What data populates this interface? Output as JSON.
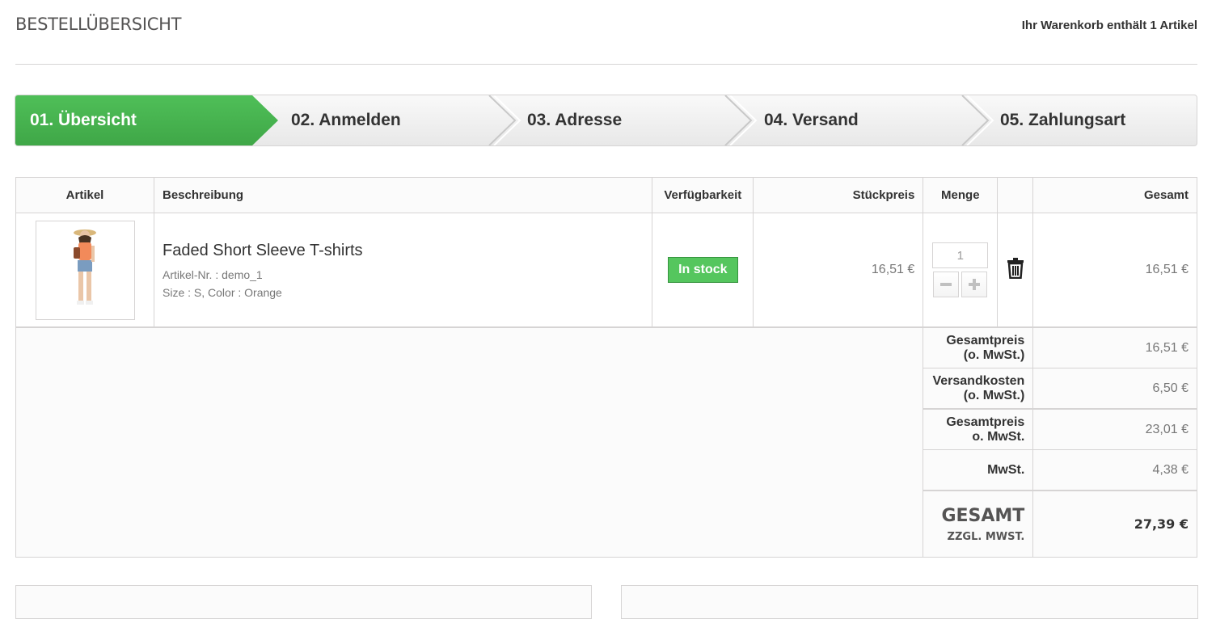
{
  "header": {
    "title": "BESTELLÜBERSICHT",
    "cart_count": "Ihr Warenkorb enthält 1 Artikel"
  },
  "steps": [
    {
      "label": "01. Übersicht",
      "active": true
    },
    {
      "label": "02. Anmelden",
      "active": false
    },
    {
      "label": "03. Adresse",
      "active": false
    },
    {
      "label": "04. Versand",
      "active": false
    },
    {
      "label": "05. Zahlungsart",
      "active": false
    }
  ],
  "colors": {
    "active_step": "#46b04f",
    "in_stock": "#55c65e"
  },
  "table": {
    "headers": {
      "artikel": "Artikel",
      "beschreibung": "Beschreibung",
      "verfuegbarkeit": "Verfügbarkeit",
      "stueckpreis": "Stückpreis",
      "menge": "Menge",
      "gesamt": "Gesamt"
    },
    "item": {
      "name": "Faded Short Sleeve T-shirts",
      "sku": "Artikel-Nr. : demo_1",
      "attributes": "Size : S, Color : Orange",
      "availability": "In stock",
      "unit_price": "16,51 €",
      "quantity": "1",
      "total": "16,51 €",
      "delete_icon": "trash-icon",
      "minus_icon": "minus-icon",
      "plus_icon": "plus-icon"
    },
    "summary": [
      {
        "label": "Gesamtpreis (o. MwSt.)",
        "value": "16,51 €"
      },
      {
        "label": "Versandkosten (o. MwSt.)",
        "value": "6,50 €"
      },
      {
        "label": "Gesamtpreis o. MwSt.",
        "value": "23,01 €"
      },
      {
        "label": "MwSt.",
        "value": "4,38 €"
      }
    ],
    "grand_total": {
      "label": "GESAMT",
      "sublabel": "ZZGL. MWST.",
      "value": "27,39 €"
    }
  }
}
